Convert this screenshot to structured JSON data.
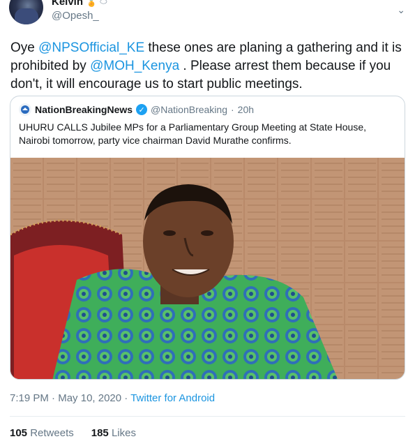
{
  "author": {
    "name": "Kelvin",
    "handle": "@Opesh_"
  },
  "tweet": {
    "t1": "Oye ",
    "mention1": "@NPSOfficial_KE",
    "t2": "  these ones are planing a gathering and it is prohibited by ",
    "mention2": "@MOH_Kenya",
    "t3": "  . Please arrest them because if you don't, it will encourage us to start public meetings."
  },
  "quoted": {
    "name": "NationBreakingNews",
    "handle": "@NationBreaking",
    "separator": "·",
    "time": "20h",
    "text": "UHURU CALLS Jubilee MPs for a Parliamentary Group Meeting at State House, Nairobi tomorrow, party vice chairman David Murathe confirms."
  },
  "meta": {
    "time": "7:19 PM",
    "sep1": "·",
    "date": "May 10, 2020",
    "sep2": "·",
    "source": "Twitter for Android"
  },
  "stats": {
    "retweets_count": "105",
    "retweets_label": "Retweets",
    "likes_count": "185",
    "likes_label": "Likes"
  },
  "icons": {
    "medal": "medal-icon",
    "ball": "rugby-ball-icon",
    "caret": "chevron-down-icon",
    "verified": "verified-badge-icon"
  },
  "colors": {
    "link": "#1b95e0",
    "muted": "#657786",
    "text": "#14171a",
    "verified": "#1da1f2",
    "border": "#ccd6dd"
  }
}
